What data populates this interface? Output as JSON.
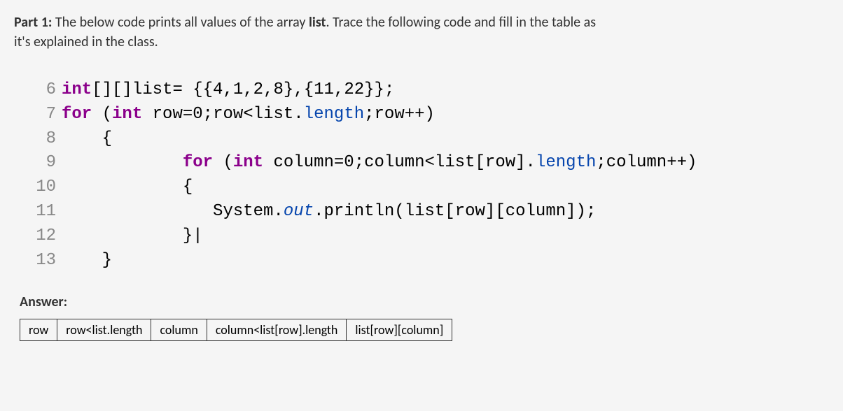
{
  "heading": {
    "part_label": "Part 1:",
    "line1": " The below code prints all values of the array ",
    "bold_word": "list",
    "line1_end": ". Trace the following code and fill in the table as",
    "line2": "it's explained in the class."
  },
  "code": {
    "lines": [
      {
        "num": "6",
        "tokens": [
          {
            "kw": "int"
          },
          {
            "plain": "[][]list= {{"
          },
          {
            "num": "4"
          },
          {
            "plain": ","
          },
          {
            "num": "1"
          },
          {
            "plain": ","
          },
          {
            "num": "2"
          },
          {
            "plain": ","
          },
          {
            "num": "8"
          },
          {
            "plain": "},{"
          },
          {
            "num": "11"
          },
          {
            "plain": ","
          },
          {
            "num": "22"
          },
          {
            "plain": "}};"
          }
        ]
      },
      {
        "num": "7",
        "tokens": [
          {
            "kw": "for"
          },
          {
            "plain": " ("
          },
          {
            "kw": "int"
          },
          {
            "plain": " row="
          },
          {
            "num": "0"
          },
          {
            "plain": ";row<list."
          },
          {
            "method": "length"
          },
          {
            "plain": ";row++)"
          }
        ]
      },
      {
        "num": "8",
        "tokens": [
          {
            "plain": "    {"
          }
        ]
      },
      {
        "num": "9",
        "tokens": [
          {
            "plain": "            "
          },
          {
            "kw": "for"
          },
          {
            "plain": " ("
          },
          {
            "kw": "int"
          },
          {
            "plain": " column="
          },
          {
            "num": "0"
          },
          {
            "plain": ";column<list[row]."
          },
          {
            "method": "length"
          },
          {
            "plain": ";column++)"
          }
        ]
      },
      {
        "num": "10",
        "tokens": [
          {
            "plain": "            {"
          }
        ]
      },
      {
        "num": "11",
        "tokens": [
          {
            "plain": "               System."
          },
          {
            "italic": "out"
          },
          {
            "plain": ".println(list[row][column]);"
          }
        ]
      },
      {
        "num": "12",
        "tokens": [
          {
            "plain": "            }|"
          }
        ]
      },
      {
        "num": "13",
        "tokens": [
          {
            "plain": "    }"
          }
        ]
      }
    ]
  },
  "answer_label": "Answer:",
  "table": {
    "headers": [
      "row",
      "row<list.length",
      "column",
      "column<list[row].length",
      "list[row][column]"
    ]
  }
}
